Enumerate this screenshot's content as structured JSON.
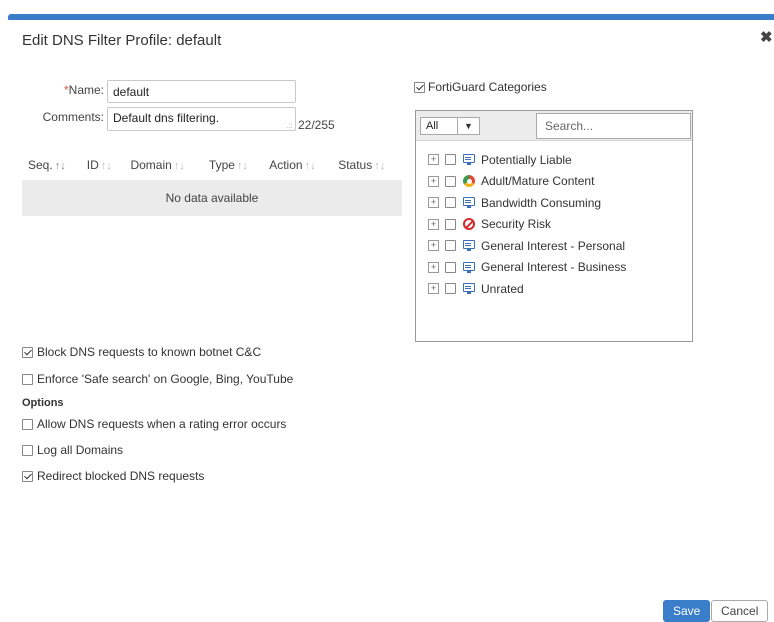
{
  "dialog": {
    "title": "Edit DNS Filter Profile: default",
    "close_glyph": "✖"
  },
  "form": {
    "name_label": "Name:",
    "name_required_mark": "*",
    "name_value": "default",
    "comments_label": "Comments:",
    "comments_value": "Default dns filtering.",
    "comments_count": "22/255"
  },
  "table": {
    "columns": [
      {
        "label": "Seq."
      },
      {
        "label": "ID"
      },
      {
        "label": "Domain"
      },
      {
        "label": "Type"
      },
      {
        "label": "Action"
      },
      {
        "label": "Status"
      }
    ],
    "empty_text": "No data available",
    "sort_glyph": "↑↓"
  },
  "fortiguard": {
    "checkbox_label": "FortiGuard Categories",
    "checked": true,
    "filter_value": "All",
    "search_placeholder": "Search...",
    "categories": [
      {
        "label": "Potentially Liable",
        "icon": "monitor-icon"
      },
      {
        "label": "Adult/Mature Content",
        "icon": "adult-content-icon"
      },
      {
        "label": "Bandwidth Consuming",
        "icon": "monitor-icon"
      },
      {
        "label": "Security Risk",
        "icon": "security-risk-icon"
      },
      {
        "label": "General Interest - Personal",
        "icon": "monitor-icon"
      },
      {
        "label": "General Interest - Business",
        "icon": "monitor-icon"
      },
      {
        "label": "Unrated",
        "icon": "monitor-icon"
      }
    ]
  },
  "options": {
    "block_botnet": {
      "label": "Block DNS requests to known botnet C&C",
      "checked": true
    },
    "safe_search": {
      "label": "Enforce 'Safe search' on Google, Bing, YouTube",
      "checked": false
    },
    "heading": "Options",
    "allow_rating_error": {
      "label": "Allow DNS requests when a rating error occurs",
      "checked": false
    },
    "log_all": {
      "label": "Log all Domains",
      "checked": false
    },
    "redirect_blocked": {
      "label": "Redirect blocked DNS requests",
      "checked": true
    }
  },
  "buttons": {
    "save": "Save",
    "cancel": "Cancel"
  },
  "colors": {
    "accent": "#3a7dc9",
    "required": "#d9534f"
  }
}
